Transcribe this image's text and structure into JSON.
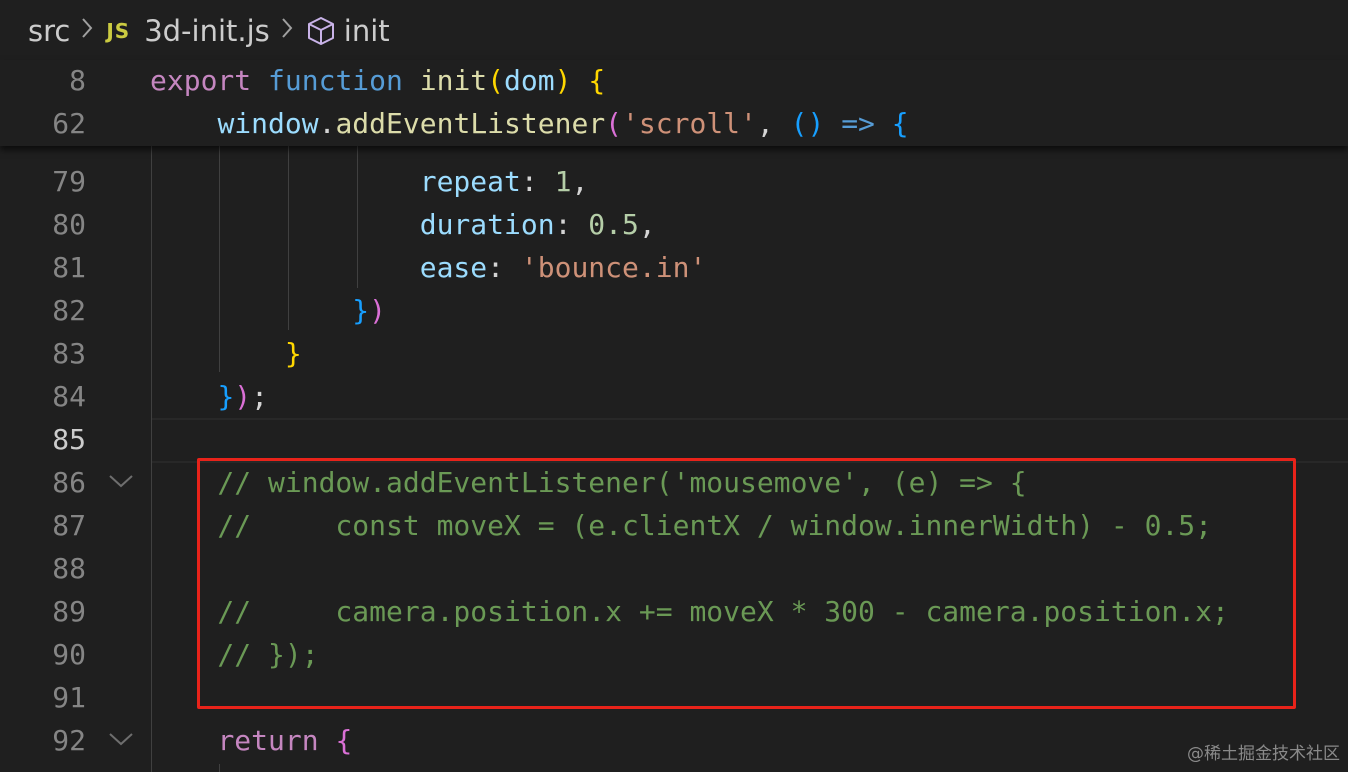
{
  "breadcrumb": {
    "folder": "src",
    "file_icon": "JS",
    "file": "3d-init.js",
    "symbol": "init"
  },
  "sticky": [
    {
      "ln": "8",
      "tokens": [
        {
          "t": "export",
          "c": "kw-purple"
        },
        {
          "t": " ",
          "c": "plain"
        },
        {
          "t": "function",
          "c": "kw-blue"
        },
        {
          "t": " ",
          "c": "plain"
        },
        {
          "t": "init",
          "c": "fn"
        },
        {
          "t": "(",
          "c": "pn1"
        },
        {
          "t": "dom",
          "c": "var"
        },
        {
          "t": ")",
          "c": "pn1"
        },
        {
          "t": " ",
          "c": "plain"
        },
        {
          "t": "{",
          "c": "pn1"
        }
      ]
    },
    {
      "ln": "62",
      "tokens": [
        {
          "t": "    ",
          "c": "plain"
        },
        {
          "t": "window",
          "c": "var"
        },
        {
          "t": ".",
          "c": "plain"
        },
        {
          "t": "addEventListener",
          "c": "fn"
        },
        {
          "t": "(",
          "c": "pn2"
        },
        {
          "t": "'scroll'",
          "c": "str"
        },
        {
          "t": ", ",
          "c": "plain"
        },
        {
          "t": "()",
          "c": "pn3"
        },
        {
          "t": " ",
          "c": "plain"
        },
        {
          "t": "=>",
          "c": "kw-blue"
        },
        {
          "t": " ",
          "c": "plain"
        },
        {
          "t": "{",
          "c": "pn3"
        }
      ]
    }
  ],
  "lines": [
    {
      "ln": "79",
      "tokens": [
        {
          "t": "                ",
          "c": "plain"
        },
        {
          "t": "repeat",
          "c": "var"
        },
        {
          "t": ": ",
          "c": "plain"
        },
        {
          "t": "1",
          "c": "num"
        },
        {
          "t": ",",
          "c": "plain"
        }
      ]
    },
    {
      "ln": "80",
      "tokens": [
        {
          "t": "                ",
          "c": "plain"
        },
        {
          "t": "duration",
          "c": "var"
        },
        {
          "t": ": ",
          "c": "plain"
        },
        {
          "t": "0.5",
          "c": "num"
        },
        {
          "t": ",",
          "c": "plain"
        }
      ]
    },
    {
      "ln": "81",
      "tokens": [
        {
          "t": "                ",
          "c": "plain"
        },
        {
          "t": "ease",
          "c": "var"
        },
        {
          "t": ": ",
          "c": "plain"
        },
        {
          "t": "'bounce.in'",
          "c": "str"
        }
      ]
    },
    {
      "ln": "82",
      "tokens": [
        {
          "t": "            ",
          "c": "plain"
        },
        {
          "t": "}",
          "c": "pn3"
        },
        {
          "t": ")",
          "c": "pn2"
        }
      ]
    },
    {
      "ln": "83",
      "tokens": [
        {
          "t": "        ",
          "c": "plain"
        },
        {
          "t": "}",
          "c": "pn1"
        }
      ]
    },
    {
      "ln": "84",
      "tokens": [
        {
          "t": "    ",
          "c": "plain"
        },
        {
          "t": "}",
          "c": "pn3"
        },
        {
          "t": ")",
          "c": "pn2"
        },
        {
          "t": ";",
          "c": "plain"
        }
      ]
    },
    {
      "ln": "85",
      "active": true,
      "tokens": []
    },
    {
      "ln": "86",
      "fold": true,
      "tokens": [
        {
          "t": "    // window.addEventListener('mousemove', (e) => {",
          "c": "cmt"
        }
      ]
    },
    {
      "ln": "87",
      "tokens": [
        {
          "t": "    //     const moveX = (e.clientX / window.innerWidth) - 0.5;",
          "c": "cmt"
        }
      ]
    },
    {
      "ln": "88",
      "tokens": []
    },
    {
      "ln": "89",
      "tokens": [
        {
          "t": "    //     camera.position.x += moveX * 300 - camera.position.x;",
          "c": "cmt"
        }
      ]
    },
    {
      "ln": "90",
      "tokens": [
        {
          "t": "    // });",
          "c": "cmt"
        }
      ]
    },
    {
      "ln": "91",
      "tokens": []
    },
    {
      "ln": "92",
      "fold": true,
      "tokens": [
        {
          "t": "    ",
          "c": "plain"
        },
        {
          "t": "return",
          "c": "kw-purple"
        },
        {
          "t": " ",
          "c": "plain"
        },
        {
          "t": "{",
          "c": "pn2"
        }
      ]
    }
  ],
  "watermark": "@稀土掘金技术社区"
}
